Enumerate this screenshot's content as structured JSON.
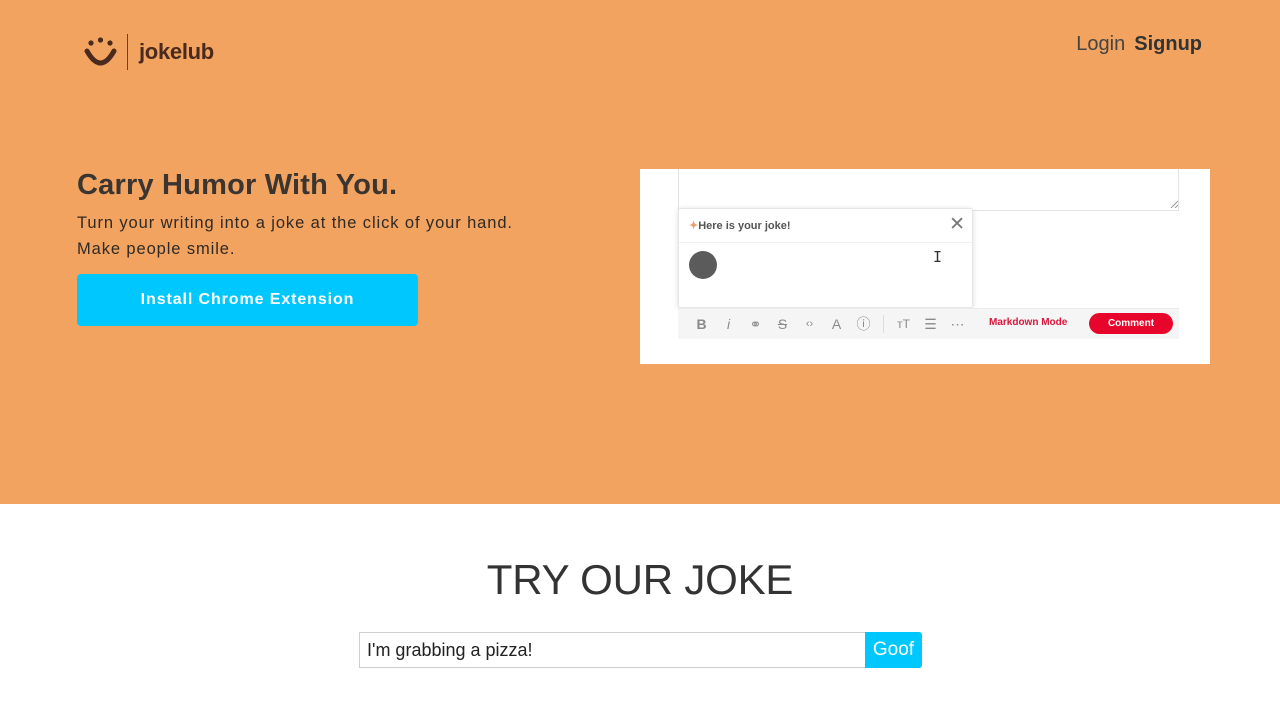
{
  "brand": {
    "name": "jokelub",
    "logo_icon": "smile-icon",
    "colors": {
      "hero_bg": "#f2a35f",
      "accent": "#00c8ff",
      "logo_dark": "#4a2a1e"
    }
  },
  "nav": {
    "login": "Login",
    "signup": "Signup"
  },
  "hero": {
    "headline": "Carry Humor With You.",
    "subline": "Turn your writing into a joke at the click of your hand. Make people smile.",
    "install_button": "Install Chrome Extension"
  },
  "preview": {
    "popup_title": "Here is your joke!",
    "close_icon": "close-icon",
    "markdown_mode": "Markdown Mode",
    "comment_button": "Comment",
    "toolbar_icons": [
      "bold-icon",
      "italic-icon",
      "link-icon",
      "strikethrough-icon",
      "code-icon",
      "text-size-icon",
      "info-icon",
      "heading-icon",
      "list-icon",
      "more-icon"
    ]
  },
  "try_section": {
    "title": "TRY OUR JOKE",
    "input_value": "I'm grabbing a pizza!",
    "submit_button": "Goof"
  }
}
